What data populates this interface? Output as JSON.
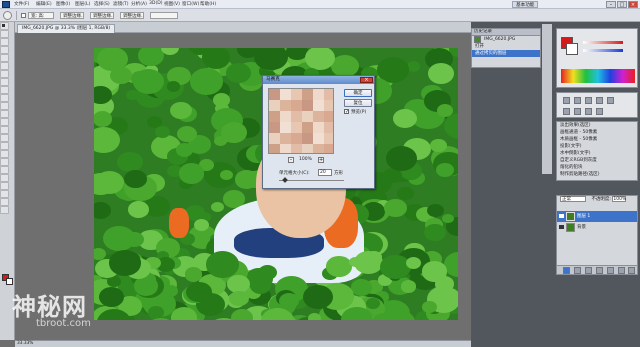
{
  "menubar": {
    "items": [
      "文件(F)",
      "编辑(E)",
      "图像(I)",
      "图层(L)",
      "选择(S)",
      "滤镜(T)",
      "分析(A)",
      "3D(D)",
      "视图(V)",
      "窗口(W)",
      "帮助(H)"
    ],
    "workspace_label": "基本功能",
    "window_buttons": [
      "–",
      "□",
      "×"
    ]
  },
  "options": {
    "field1": "宽: 高:",
    "field2": "调整边缘...",
    "field3": "调整边缘...",
    "field4": "调整边缘..."
  },
  "document": {
    "tab_label": "IMG_6620.JPG @ 33.3% (图层 1, RGB/8)",
    "status": "33.33%"
  },
  "watermark": {
    "main": "神秘网",
    "sub": "tbroot.com"
  },
  "dialog": {
    "title": "马赛克",
    "close": "×",
    "zoom": "100%",
    "zoom_minus": "–",
    "zoom_plus": "+",
    "ok": "确定",
    "reset": "复位",
    "preview_label": "预览(P)",
    "preview_checked": "✓",
    "cell_label": "单元格大小(C):",
    "cell_value": "20",
    "cell_unit": "方形"
  },
  "history": {
    "title": "历史记录",
    "snapshot": "IMG_6620.JPG",
    "items": [
      "打开",
      "通过拷贝的图层"
    ]
  },
  "actions": {
    "title": "动作",
    "items": [
      "淡出效果(选区)",
      "画框通道 - 50像素",
      "木质画框 - 50像素",
      "投影(文字)",
      "水中倒影(文字)",
      "自定义RGB到灰度",
      "熔化的铅块",
      "制作剪贴路径(选区)",
      "棕褐色调(图层)",
      "四分颜色",
      "存储为Photoshop PDF",
      "渐变映射"
    ]
  },
  "layers": {
    "mode": "正常",
    "opacity_label": "不透明度:",
    "opacity": "100%",
    "items": [
      {
        "name": "图层 1",
        "selected": true
      },
      {
        "name": "背景",
        "selected": false
      }
    ]
  },
  "colors": {
    "accent": "#3d73c8",
    "foreground": "#d41a1a",
    "background": "#ffffff"
  }
}
